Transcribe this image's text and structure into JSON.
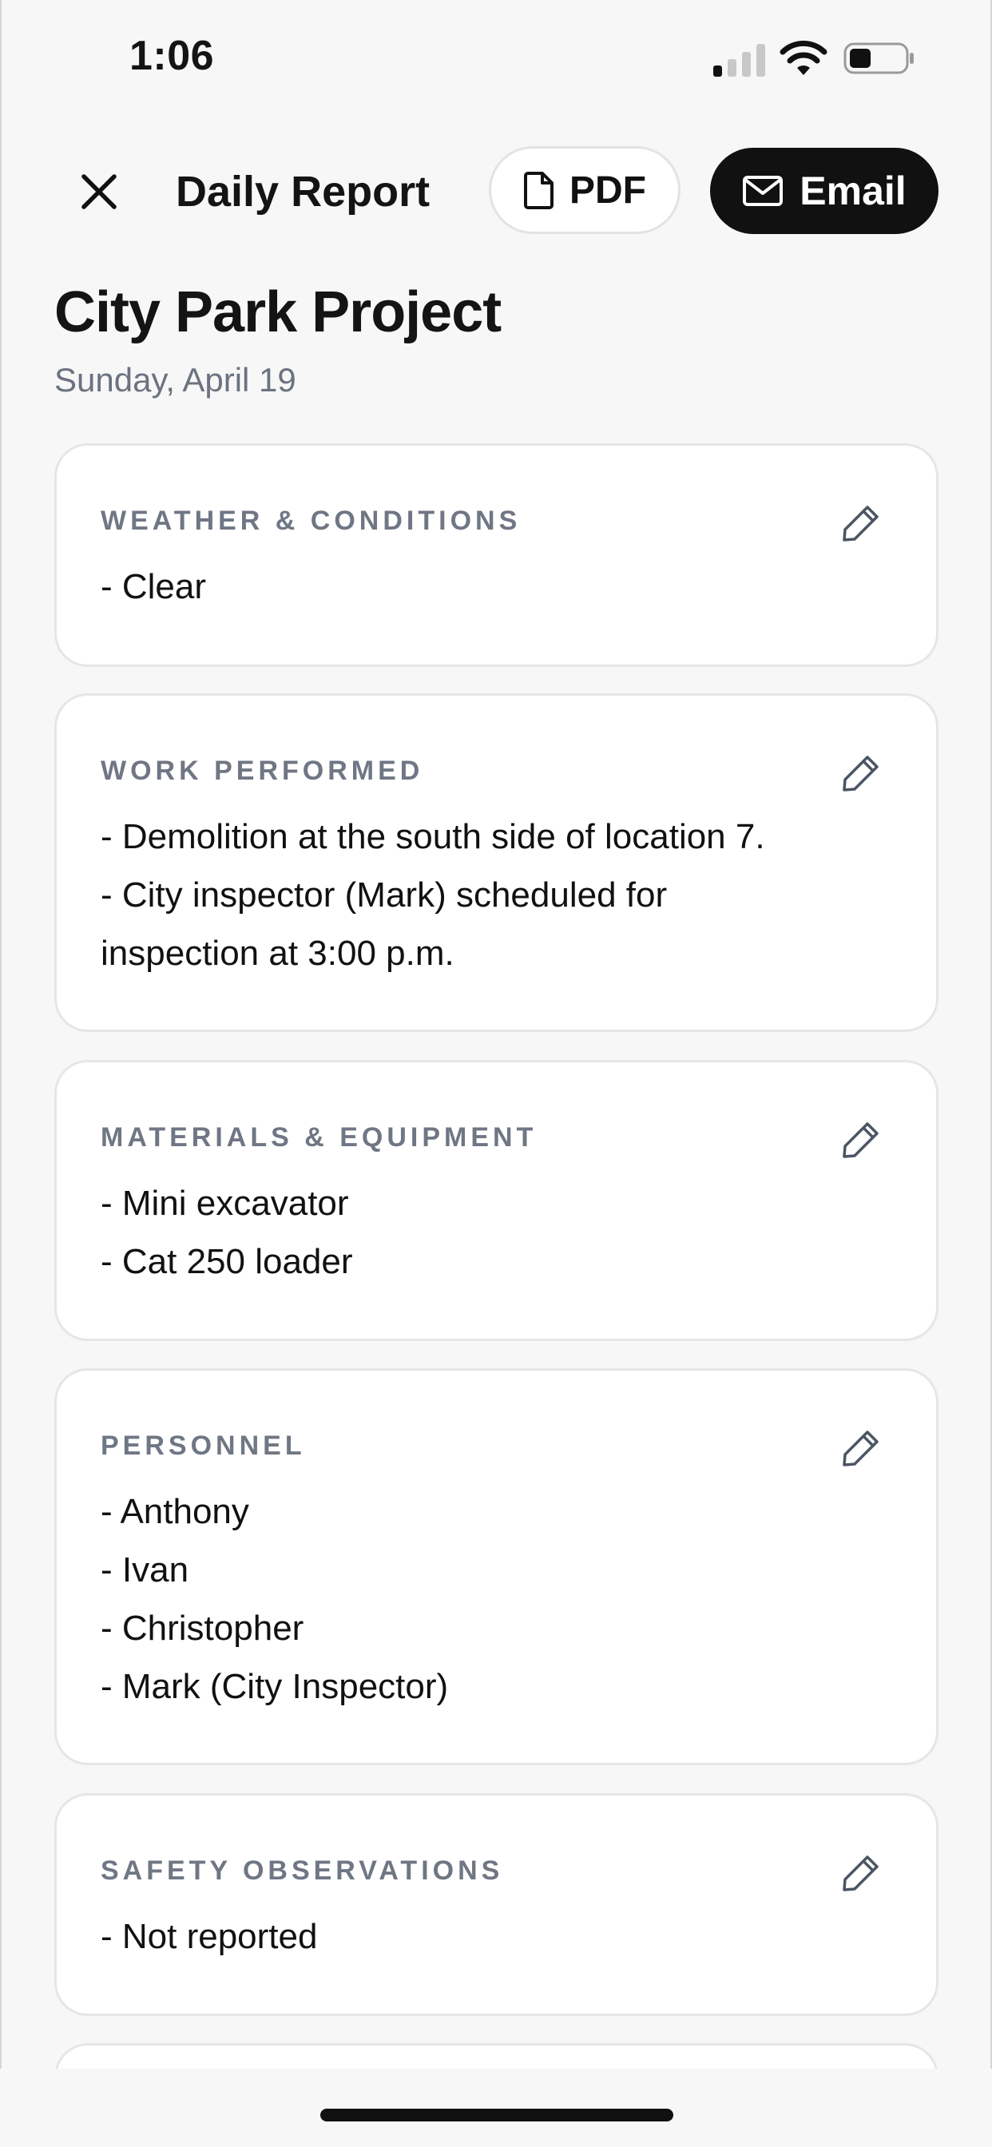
{
  "status_bar": {
    "time": "1:06"
  },
  "header": {
    "title": "Daily Report",
    "pdf_label": "PDF",
    "email_label": "Email"
  },
  "project": {
    "name": "City Park Project",
    "date": "Sunday, April 19"
  },
  "sections": [
    {
      "label": "WEATHER & CONDITIONS",
      "lines": [
        "- Clear"
      ]
    },
    {
      "label": "WORK PERFORMED",
      "lines": [
        "- Demolition at the south side of location 7.",
        "- City inspector (Mark) scheduled for",
        "inspection at 3:00 p.m."
      ]
    },
    {
      "label": "MATERIALS & EQUIPMENT",
      "lines": [
        "- Mini excavator",
        "- Cat 250 loader"
      ]
    },
    {
      "label": "PERSONNEL",
      "lines": [
        "- Anthony",
        "- Ivan",
        "- Christopher",
        "- Mark (City Inspector)"
      ]
    },
    {
      "label": "SAFETY OBSERVATIONS",
      "lines": [
        "- Not reported"
      ]
    }
  ],
  "icons": {
    "close": "close-icon",
    "pdf": "document-icon",
    "email": "envelope-icon",
    "edit": "pencil-icon"
  },
  "colors": {
    "background": "#f7f7f7",
    "card": "#ffffff",
    "primary_button": "#111111",
    "section_label": "#6f7684",
    "muted_text": "#6b7280"
  }
}
